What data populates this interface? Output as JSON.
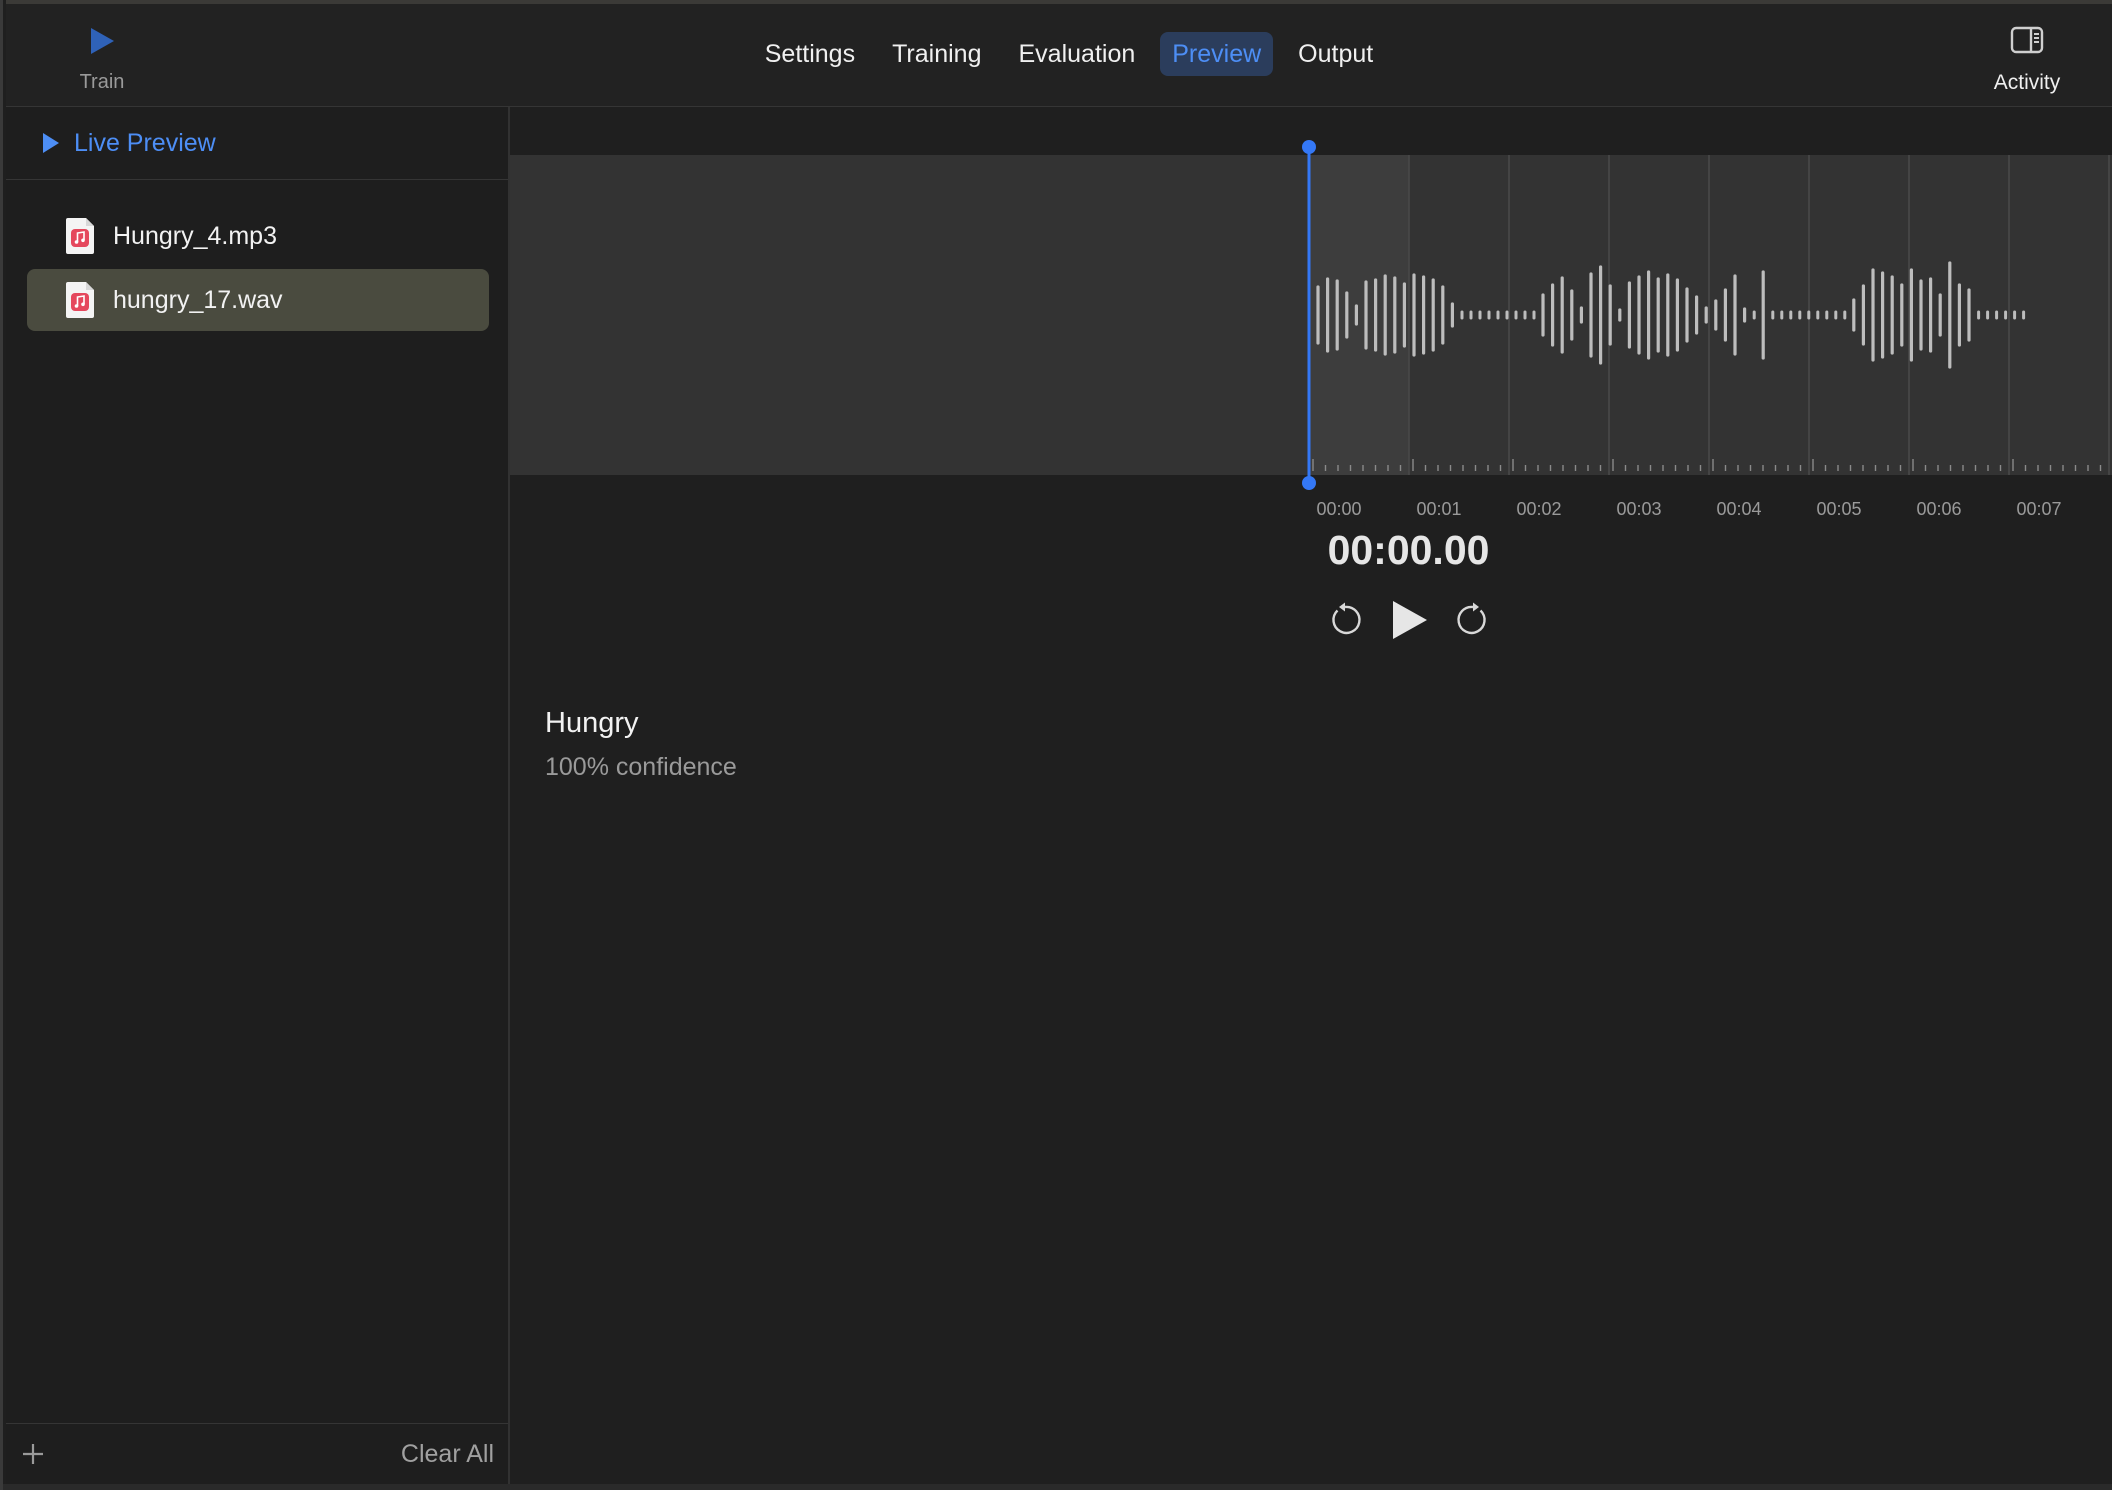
{
  "toolbar": {
    "train_label": "Train",
    "activity_label": "Activity",
    "tabs": [
      {
        "label": "Settings",
        "active": false
      },
      {
        "label": "Training",
        "active": false
      },
      {
        "label": "Evaluation",
        "active": false
      },
      {
        "label": "Preview",
        "active": true
      },
      {
        "label": "Output",
        "active": false
      }
    ]
  },
  "sidebar": {
    "live_preview_label": "Live Preview",
    "files": [
      {
        "name": "Hungry_4.mp3",
        "selected": false
      },
      {
        "name": "hungry_17.wav",
        "selected": true
      }
    ],
    "clear_all_label": "Clear All"
  },
  "player": {
    "timeline_labels": [
      "00:00",
      "00:01",
      "00:02",
      "00:03",
      "00:04",
      "00:05",
      "00:06",
      "00:07"
    ],
    "current_time": "00:00.00"
  },
  "result": {
    "label": "Hungry",
    "confidence": "100% confidence"
  },
  "colors": {
    "accent": "#4d8ef5",
    "playhead": "#3478f6",
    "selected_row": "#4a4b3f",
    "waveform": "#bdbdbd",
    "file_icon": "#e5485d"
  },
  "icons": {
    "train": "play-triangle-icon",
    "activity": "sidebar-right-icon",
    "live_preview": "play-triangle-icon",
    "file": "audio-file-icon",
    "add": "plus-icon",
    "skip_back": "rotate-back-icon",
    "play": "play-icon",
    "skip_forward": "rotate-forward-icon"
  }
}
